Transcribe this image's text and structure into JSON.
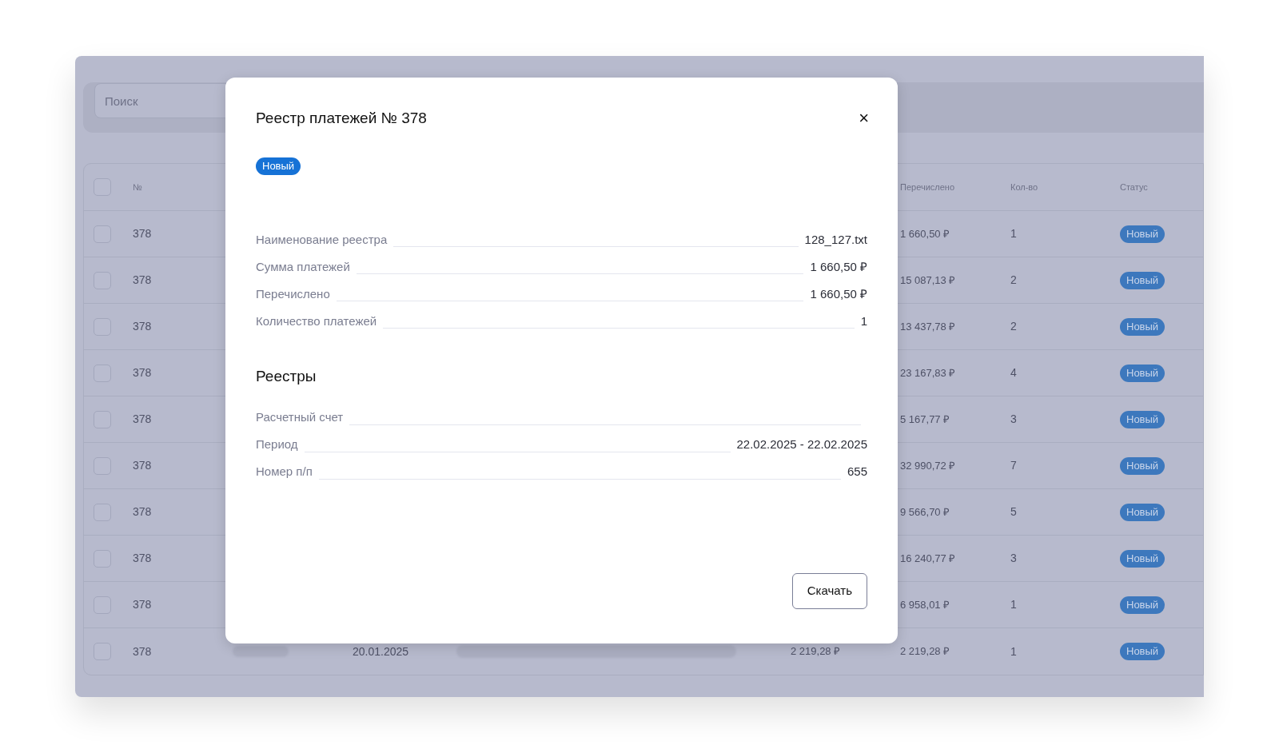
{
  "search": {
    "placeholder": "Поиск"
  },
  "table": {
    "columns": [
      "№",
      "Перечислено",
      "Кол-во",
      "Статус"
    ],
    "header_checked": false,
    "rows": [
      {
        "checked": false,
        "number": "378",
        "transferred": "1 660,50 ₽",
        "count": "1",
        "status": "Новый"
      },
      {
        "checked": false,
        "number": "378",
        "transferred": "15 087,13 ₽",
        "count": "2",
        "status": "Новый"
      },
      {
        "checked": false,
        "number": "378",
        "transferred": "13 437,78 ₽",
        "count": "2",
        "status": "Новый"
      },
      {
        "checked": false,
        "number": "378",
        "transferred": "23 167,83 ₽",
        "count": "4",
        "status": "Новый"
      },
      {
        "checked": false,
        "number": "378",
        "transferred": "5 167,77 ₽",
        "count": "3",
        "status": "Новый"
      },
      {
        "checked": false,
        "number": "378",
        "transferred": "32 990,72 ₽",
        "count": "7",
        "status": "Новый"
      },
      {
        "checked": false,
        "number": "378",
        "transferred": "9 566,70 ₽",
        "count": "5",
        "status": "Новый"
      },
      {
        "checked": false,
        "number": "378",
        "transferred": "16 240,77 ₽",
        "count": "3",
        "status": "Новый"
      },
      {
        "checked": false,
        "number": "378",
        "transferred": "6 958,01 ₽",
        "count": "1",
        "status": "Новый"
      },
      {
        "checked": false,
        "number": "378",
        "date": "20.01.2025",
        "sum": "2 219,28 ₽",
        "transferred": "2 219,28 ₽",
        "count": "1",
        "status": "Новый"
      }
    ]
  },
  "modal": {
    "title": "Реестр платежей № 378",
    "close": "×",
    "status": "Новый",
    "details": [
      {
        "label": "Наименование реестра",
        "value": "128_127.txt"
      },
      {
        "label": "Сумма платежей",
        "value": "1 660,50 ₽"
      },
      {
        "label": "Перечислено",
        "value": "1 660,50 ₽"
      },
      {
        "label": "Количество платежей",
        "value": "1"
      }
    ],
    "section_title": "Реестры",
    "registry": [
      {
        "label": "Расчетный счет"
      },
      {
        "label": "Период",
        "value": "22.02.2025 - 22.02.2025"
      },
      {
        "label": "Номер п/п",
        "value": "655"
      }
    ],
    "button": "Скачать"
  }
}
